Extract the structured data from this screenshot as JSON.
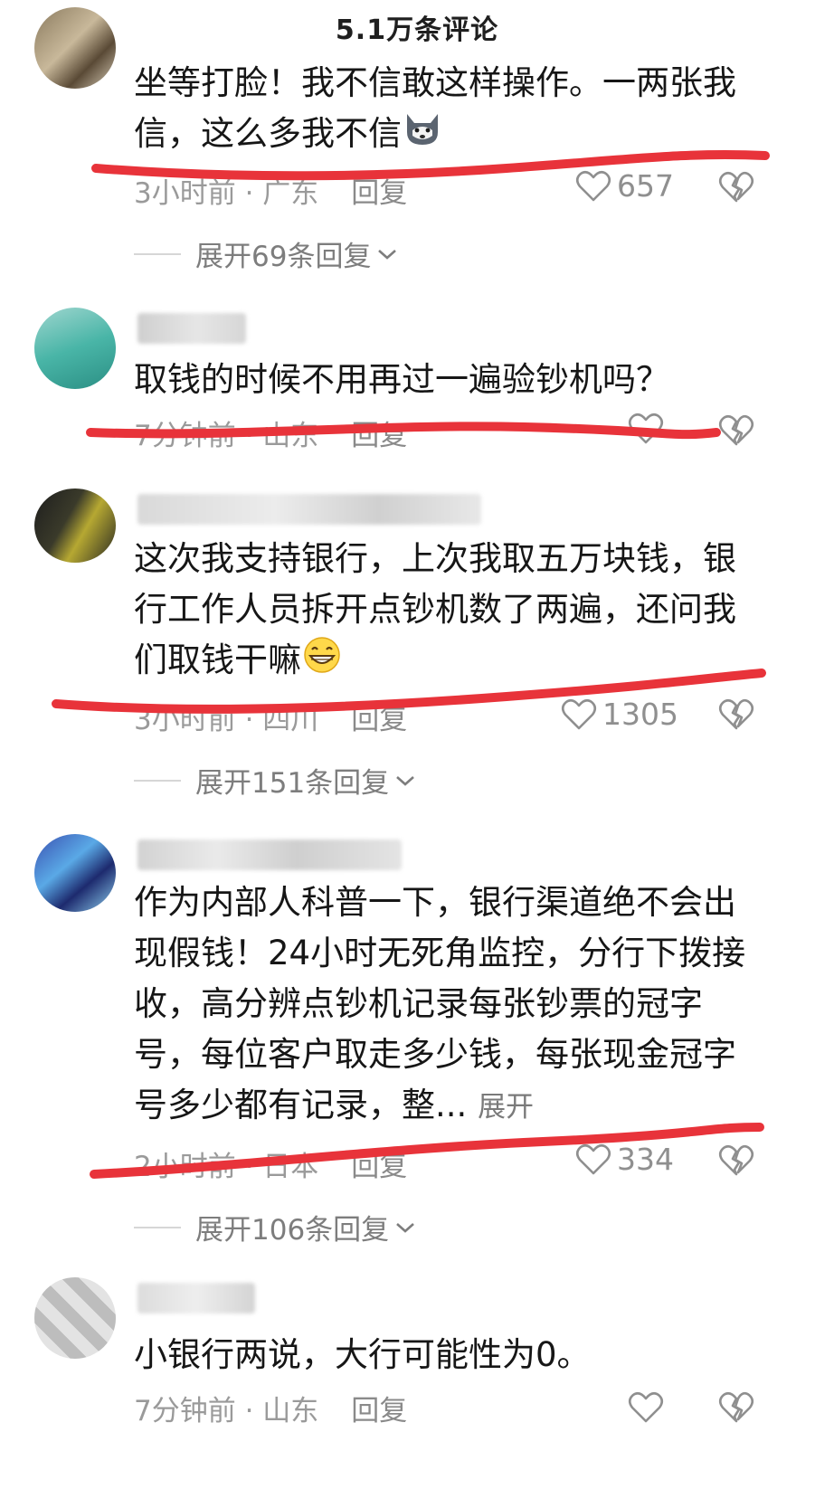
{
  "header": {
    "title": "5.1万条评论"
  },
  "comments": [
    {
      "text": "坐等打脸！我不信敢这样操作。一两张我信，这么多我不信",
      "time": "3小时前 · 广东",
      "reply": "回复",
      "likes": "657",
      "replies_label": "展开69条回复"
    },
    {
      "text": "取钱的时候不用再过一遍验钞机吗？",
      "time": "7分钟前 · 山东",
      "reply": "回复"
    },
    {
      "text": "这次我支持银行，上次我取五万块钱，银行工作人员拆开点钞机数了两遍，还问我们取钱干嘛",
      "time": "3小时前 · 四川",
      "reply": "回复",
      "likes": "1305",
      "replies_label": "展开151条回复"
    },
    {
      "text": "作为内部人科普一下，银行渠道绝不会出现假钱！24小时无死角监控，分行下拨接收，高分辨点钞机记录每张钞票的冠字号，每位客户取走多少钱，每张现金冠字号多少都有记录，整...",
      "more": "展开",
      "time": "2小时前 · 日本",
      "reply": "回复",
      "likes": "334",
      "replies_label": "展开106条回复"
    },
    {
      "text": "小银行两说，大行可能性为0。",
      "time": "7分钟前 · 山东",
      "reply": "回复"
    }
  ],
  "icons": {
    "like": "heart-outline-icon",
    "dislike": "broken-heart-icon",
    "expand": "chevron-down-icon",
    "emoji_1": "husky-emoji-icon",
    "emoji_2": "grin-emoji-icon"
  },
  "colors": {
    "annotation": "#e8333a",
    "meta_text": "#9a9a9a",
    "body_text": "#161616"
  }
}
